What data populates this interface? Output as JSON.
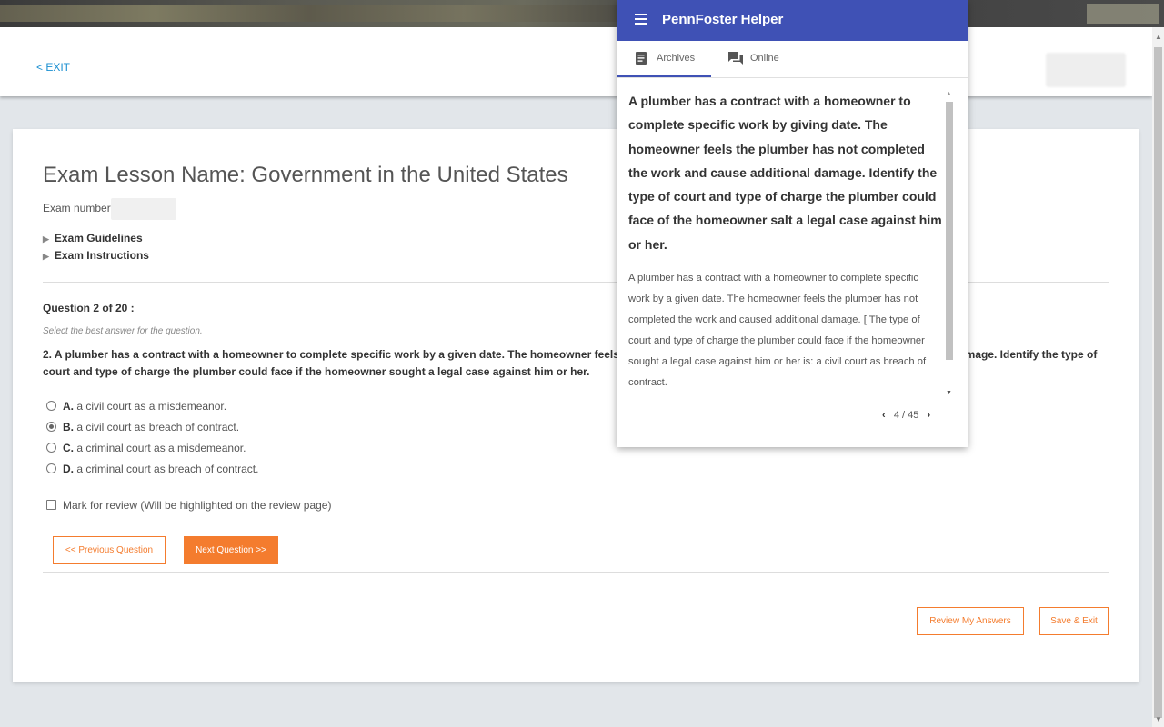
{
  "header": {
    "exit_label": "< EXIT"
  },
  "exam": {
    "title": "Exam Lesson Name: Government in the United States",
    "number_label": "Exam number",
    "guidelines": "Exam Guidelines",
    "instructions": "Exam Instructions"
  },
  "question": {
    "header": "Question 2 of 20 :",
    "hint": "Select the best answer for the question.",
    "text": "2.  A plumber has a contract with a homeowner to complete specific work by a given date. The homeowner feels the plumber has not completed the work and caused additional damage. Identify the type of court and type of charge the plumber could face if the homeowner sought a legal case against him or her.",
    "options": [
      {
        "letter": "A.",
        "text": " a civil court as a misdemeanor.",
        "selected": false
      },
      {
        "letter": "B.",
        "text": " a civil court as breach of contract.",
        "selected": true
      },
      {
        "letter": "C.",
        "text": " a criminal court as a misdemeanor.",
        "selected": false
      },
      {
        "letter": "D.",
        "text": " a criminal court as breach of contract.",
        "selected": false
      }
    ],
    "mark_review": "Mark for review (Will be highlighted on the review page)"
  },
  "buttons": {
    "prev": "<< Previous Question",
    "next": "Next Question >>",
    "review": "Review My Answers",
    "save_exit": "Save & Exit"
  },
  "helper": {
    "title": "PennFoster Helper",
    "tabs": [
      {
        "label": "Archives",
        "icon": "document-icon",
        "active": true
      },
      {
        "label": "Online",
        "icon": "forum-icon",
        "active": false
      }
    ],
    "found_question": "A plumber has a contract with a homeowner to complete specific work by giving date. The homeowner feels the plumber has not completed the work and cause additional damage. Identify the type of court and type of charge the plumber could face of the homeowner salt a legal case against him or her.",
    "answer": "A plumber has a contract with a homeowner to complete specific work by a given date. The homeowner feels the plumber has not completed the work and caused additional damage. [  The type of court and type of charge the plumber could face if the homeowner sought a legal case against him or her is: a civil court as breach of contract.",
    "pager": "4 / 45"
  },
  "colors": {
    "accent_orange": "#f47c2e",
    "helper_blue": "#3f51b5",
    "link_blue": "#1a8fd1"
  }
}
